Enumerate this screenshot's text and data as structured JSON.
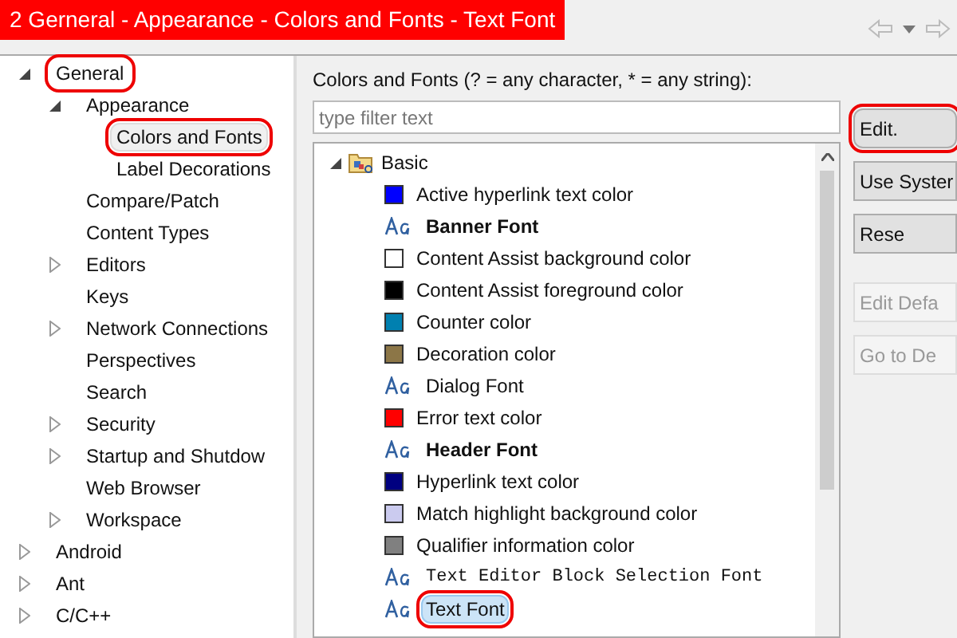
{
  "window": {
    "title": "2 Gerneral - Appearance - Colors and Fonts - Text Font"
  },
  "sidebar": {
    "items": [
      {
        "label": "General",
        "expanded": true,
        "selected": false,
        "annotated": true,
        "children": [
          {
            "label": "Appearance",
            "expanded": true,
            "selected": false,
            "children": [
              {
                "label": "Colors and Fonts",
                "selected": true,
                "annotated": true
              },
              {
                "label": "Label Decorations",
                "selected": false
              }
            ]
          },
          {
            "label": "Compare/Patch",
            "selected": false
          },
          {
            "label": "Content Types",
            "selected": false
          },
          {
            "label": "Editors",
            "expanded": false,
            "selected": false
          },
          {
            "label": "Keys",
            "selected": false
          },
          {
            "label": "Network Connections",
            "expanded": false,
            "selected": false
          },
          {
            "label": "Perspectives",
            "selected": false
          },
          {
            "label": "Search",
            "selected": false
          },
          {
            "label": "Security",
            "expanded": false,
            "selected": false
          },
          {
            "label": "Startup and Shutdow",
            "expanded": false,
            "selected": false
          },
          {
            "label": "Web Browser",
            "selected": false
          },
          {
            "label": "Workspace",
            "expanded": false,
            "selected": false
          }
        ]
      },
      {
        "label": "Android",
        "expanded": false,
        "selected": false
      },
      {
        "label": "Ant",
        "expanded": false,
        "selected": false
      },
      {
        "label": "C/C++",
        "expanded": false,
        "selected": false
      }
    ]
  },
  "content": {
    "heading": "Colors and Fonts (? = any character, * = any string):",
    "filter": {
      "placeholder": "type filter text"
    },
    "category": {
      "label": "Basic",
      "expanded": true
    },
    "entries": [
      {
        "kind": "color",
        "label": "Active hyperlink text color",
        "color": "#0000ff",
        "selected": false
      },
      {
        "kind": "boldfont",
        "label": "Banner Font",
        "selected": false
      },
      {
        "kind": "color",
        "label": "Content Assist background color",
        "color": "#ffffff",
        "selected": false
      },
      {
        "kind": "color",
        "label": "Content Assist foreground color",
        "color": "#000000",
        "selected": false
      },
      {
        "kind": "color",
        "label": "Counter color",
        "color": "#0080b0",
        "selected": false
      },
      {
        "kind": "color",
        "label": "Decoration color",
        "color": "#8c7647",
        "selected": false
      },
      {
        "kind": "font",
        "label": "Dialog Font",
        "selected": false
      },
      {
        "kind": "color",
        "label": "Error text color",
        "color": "#ff0000",
        "selected": false
      },
      {
        "kind": "boldfont",
        "label": "Header Font",
        "selected": false
      },
      {
        "kind": "color",
        "label": "Hyperlink text color",
        "color": "#000080",
        "selected": false
      },
      {
        "kind": "color",
        "label": "Match highlight background color",
        "color": "#cbcbef",
        "selected": false
      },
      {
        "kind": "color",
        "label": "Qualifier information color",
        "color": "#808080",
        "selected": false
      },
      {
        "kind": "monofont",
        "label": "Text Editor Block Selection Font",
        "selected": false
      },
      {
        "kind": "font",
        "label": "Text Font",
        "selected": true,
        "annotated": true
      }
    ],
    "buttons": [
      {
        "label": "Edit.",
        "disabled": false,
        "annotated": true
      },
      {
        "label": "Use Syster",
        "disabled": false
      },
      {
        "label": "Rese",
        "disabled": false
      },
      {
        "label": "Edit Defa",
        "disabled": true
      },
      {
        "label": "Go to De",
        "disabled": true
      }
    ]
  }
}
